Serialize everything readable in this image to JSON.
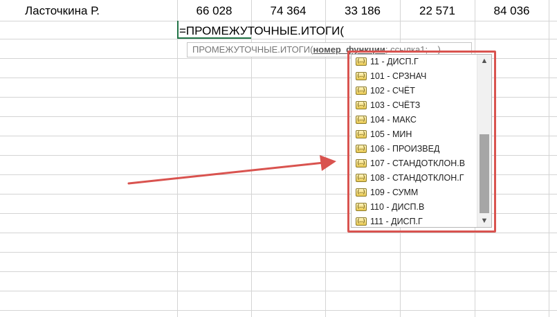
{
  "row": {
    "name": "Ласточкина Р.",
    "values": [
      "66 028",
      "74 364",
      "33 186",
      "22 571",
      "84 036"
    ]
  },
  "formula": "=ПРОМЕЖУТОЧНЫЕ.ИТОГИ(",
  "tooltip": {
    "fn": "ПРОМЕЖУТОЧНЫЕ.ИТОГИ(",
    "arg1": "номер_функции",
    "rest": "; ссылка1; ...)"
  },
  "dropdown": {
    "icon_label": "(...)",
    "items": [
      "11 - ДИСП.Г",
      "101 - СРЗНАЧ",
      "102 - СЧЁТ",
      "103 - СЧЁТЗ",
      "104 - МАКС",
      "105 - МИН",
      "106 - ПРОИЗВЕД",
      "107 - СТАНДОТКЛОН.В",
      "108 - СТАНДОТКЛОН.Г",
      "109 - СУММ",
      "110 - ДИСП.В",
      "111 - ДИСП.Г"
    ],
    "scroll_up": "▲",
    "scroll_down": "▼"
  },
  "colors": {
    "highlight": "#d9534f",
    "selection": "#217346",
    "arrow": "#d9534f"
  }
}
